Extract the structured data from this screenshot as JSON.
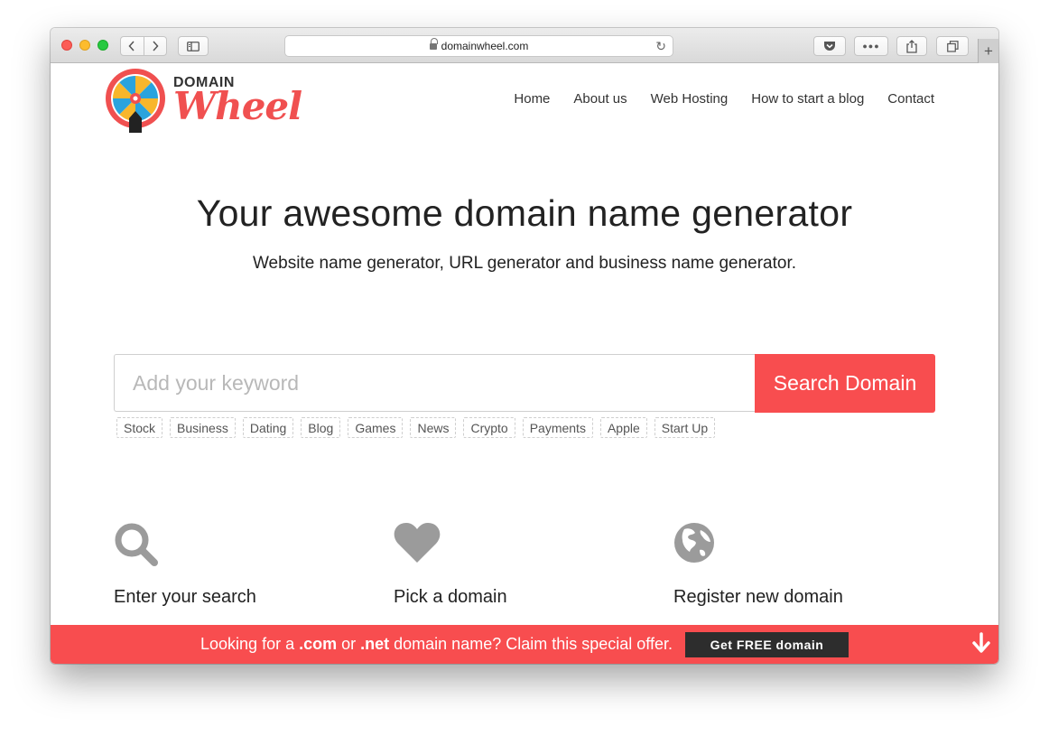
{
  "browser": {
    "url": "domainwheel.com",
    "new_tab_symbol": "+"
  },
  "logo": {
    "top_word": "DOMAIN",
    "main_word": "Wheel"
  },
  "nav": {
    "items": [
      "Home",
      "About us",
      "Web Hosting",
      "How to start a blog",
      "Contact"
    ]
  },
  "hero": {
    "title": "Your awesome domain name generator",
    "subtitle": "Website name generator, URL generator and business name generator."
  },
  "search": {
    "placeholder": "Add your keyword",
    "button_label": "Search Domain",
    "tags": [
      "Stock",
      "Business",
      "Dating",
      "Blog",
      "Games",
      "News",
      "Crypto",
      "Payments",
      "Apple",
      "Start Up"
    ]
  },
  "features": [
    {
      "icon": "search-icon",
      "label": "Enter your search"
    },
    {
      "icon": "heart-icon",
      "label": "Pick a domain"
    },
    {
      "icon": "globe-icon",
      "label": "Register new domain"
    }
  ],
  "promo": {
    "text_1": "Looking for a ",
    "ext_com": ".com",
    "text_2": " or ",
    "ext_net": ".net",
    "text_3": " domain name? Claim this special offer.",
    "button_label": "Get FREE domain"
  },
  "colors": {
    "accent": "#f84d4f",
    "promo_button": "#2d2d2d",
    "icon_gray": "#9b9b9b"
  }
}
